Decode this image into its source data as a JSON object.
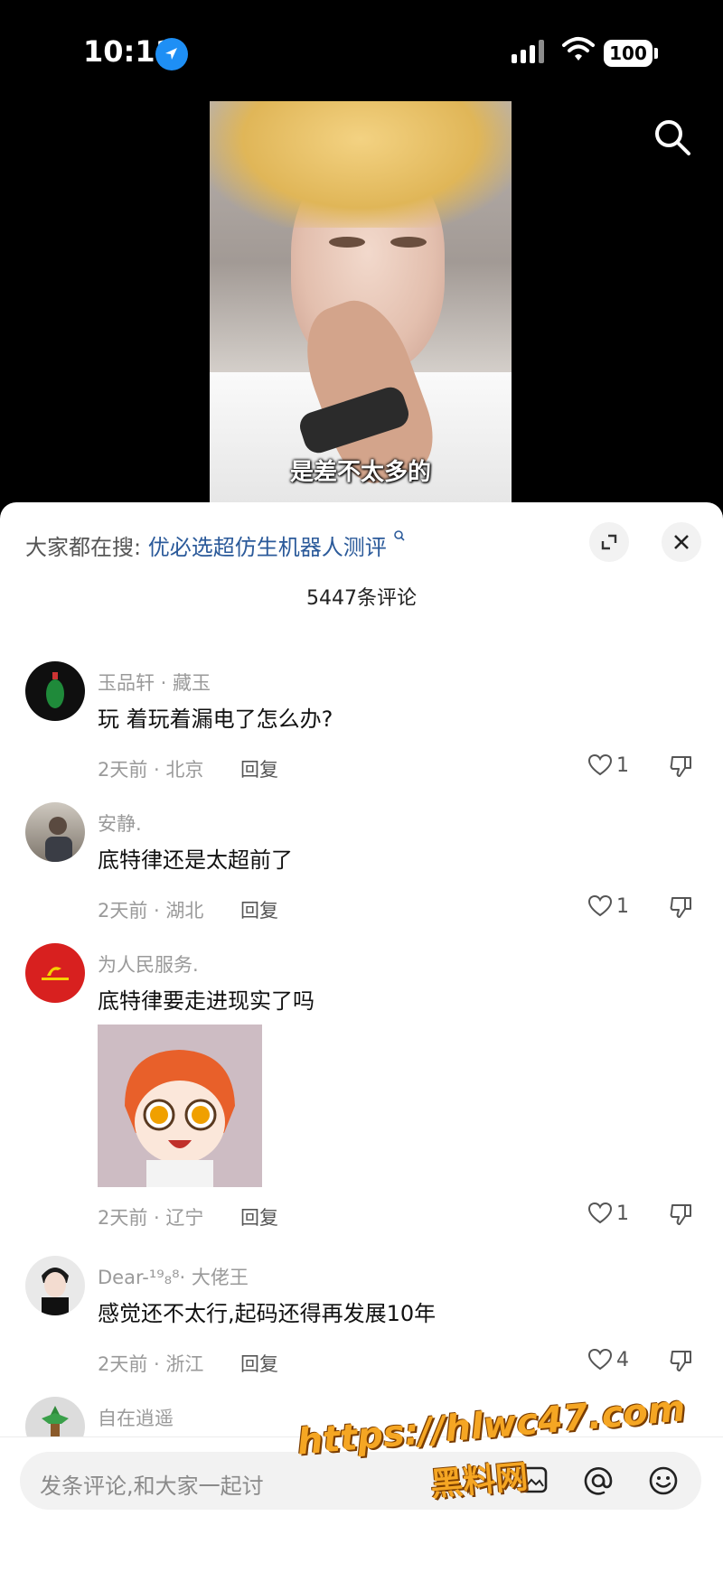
{
  "status_bar": {
    "time": "10:11",
    "battery": "100"
  },
  "video": {
    "subtitle": "是差不太多的"
  },
  "search_suggest": {
    "prefix": "大家都在搜:",
    "query": "优必选超仿生机器人测评"
  },
  "comment_count": "5447条评论",
  "comments": [
    {
      "user": "玉品轩 · 藏玉",
      "text": "玩 着玩着漏电了怎么办?",
      "meta": "2天前 · 北京",
      "reply": "回复",
      "likes": "1"
    },
    {
      "user": "安静.",
      "text": "底特律还是太超前了",
      "meta": "2天前 · 湖北",
      "reply": "回复",
      "likes": "1"
    },
    {
      "user": "为人民服务.",
      "text": "底特律要走进现实了吗",
      "meta": "2天前 · 辽宁",
      "reply": "回复",
      "likes": "1"
    },
    {
      "user": "Dear-¹⁹₈⁸· 大佬王",
      "text": "感觉还不太行,起码还得再发展10年",
      "meta": "2天前 · 浙江",
      "reply": "回复",
      "likes": "4"
    },
    {
      "user": "自在逍遥"
    }
  ],
  "input": {
    "placeholder": "发条评论,和大家一起讨"
  },
  "watermark": {
    "url": "https://hlwc47.com",
    "name": "黑料网"
  },
  "colors": {
    "link": "#2b5a9a",
    "location_blue": "#1e8ff5",
    "watermark_orange": "#f5a623"
  },
  "icons": [
    "location-arrow-icon",
    "signal-icon",
    "wifi-icon",
    "search-icon",
    "expand-icon",
    "close-icon",
    "heart-icon",
    "dislike-icon",
    "image-icon",
    "at-icon",
    "emoji-icon"
  ]
}
